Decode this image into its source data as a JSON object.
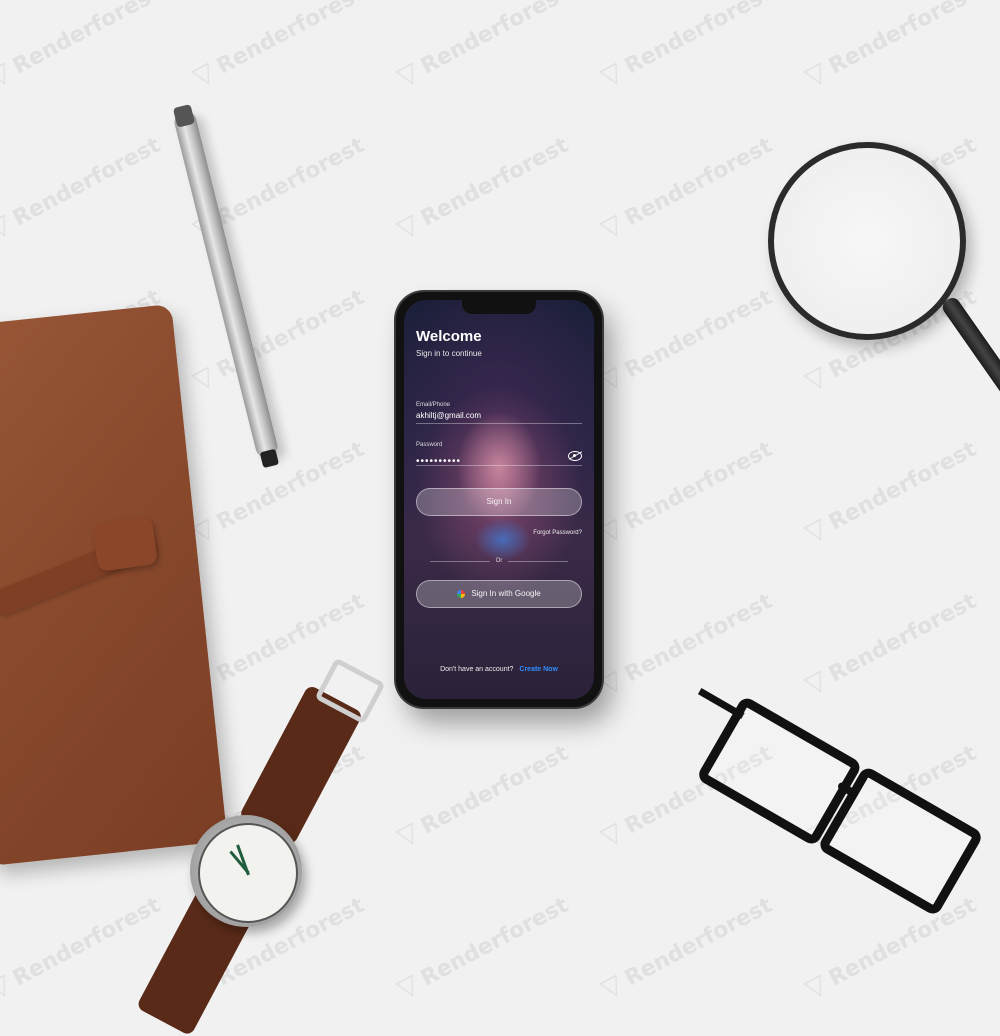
{
  "scene": {
    "watermark_text": "Renderforest"
  },
  "screen": {
    "title": "Welcome",
    "subtitle": "Sign in to continue",
    "email_label": "Email/Phone",
    "email_value": "akhiltj@gmail.com",
    "password_label": "Password",
    "password_value": "••••••••••",
    "sign_in_label": "Sign In",
    "forgot_password_label": "Forgot Password?",
    "or_label": "Or",
    "google_sign_in_label": "Sign In with Google",
    "no_account_text": "Don't have an account?",
    "create_account_label": "Create Now"
  },
  "colors": {
    "link": "#2f8cff",
    "background": "#f1f1f1"
  }
}
